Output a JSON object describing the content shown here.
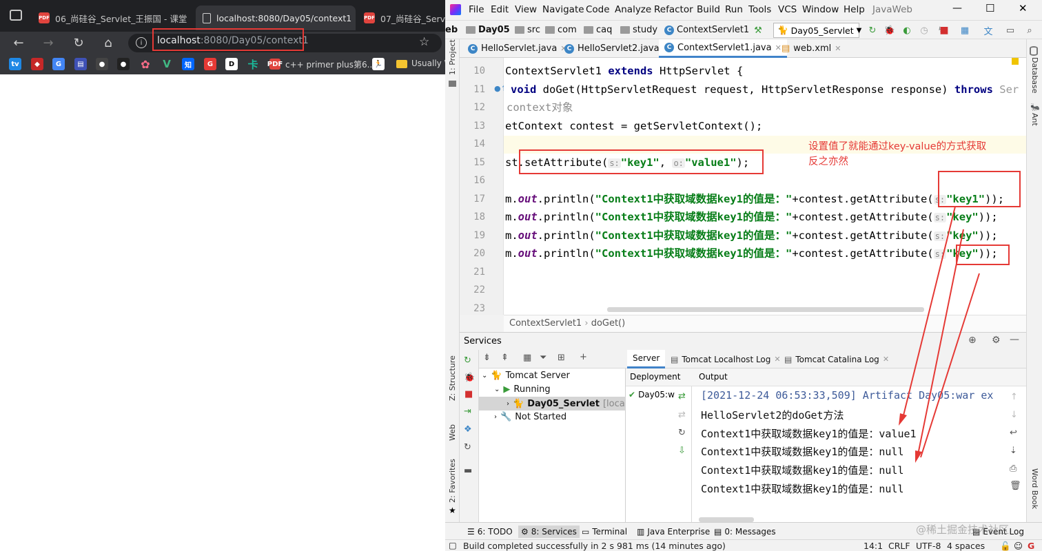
{
  "browser": {
    "tabs": [
      {
        "label": "06_尚硅谷_Servlet_王振国 - 课堂",
        "icon": "pdf-icon"
      },
      {
        "label": "localhost:8080/Day05/context1",
        "icon": "page-icon"
      },
      {
        "label": "07_尚硅谷_Servlet",
        "icon": "pdf-icon"
      }
    ],
    "url_host": "localhost",
    "url_rest": ":8080/Day05/context1",
    "bookmarks": [
      "c++ primer plus第6...",
      "Usually W"
    ]
  },
  "ide": {
    "menus": [
      "File",
      "Edit",
      "View",
      "Navigate",
      "Code",
      "Analyze",
      "Refactor",
      "Build",
      "Run",
      "Tools",
      "VCS",
      "Window",
      "Help"
    ],
    "project_title": "JavaWeb",
    "breadcrumbs": [
      "eb",
      "Day05",
      "src",
      "com",
      "caq",
      "study",
      "ContextServlet1"
    ],
    "run_config": "Day05_Servlet",
    "editor_tabs": [
      {
        "label": "HelloServlet.java",
        "active": false
      },
      {
        "label": "HelloServlet2.java",
        "active": false
      },
      {
        "label": "ContextServlet1.java",
        "active": true
      },
      {
        "label": "web.xml",
        "active": false
      }
    ],
    "line_numbers": [
      "10",
      "11",
      "12",
      "13",
      "14",
      "15",
      "16",
      "17",
      "18",
      "19",
      "20",
      "21",
      "22",
      "23"
    ],
    "code": {
      "l10_name": "ContextServlet1 ",
      "l10_kw": "extends",
      "l10_rest": " HttpServlet {",
      "l11_kw1": "void",
      "l11_mid": " doGet(HttpServletRequest request, HttpServletResponse response) ",
      "l11_kw2": "throws",
      "l11_end": " Ser",
      "l12_comment": "context对象",
      "l13": "etContext contest = getServletContext();",
      "l15_a": "st.setAttribute(",
      "hint_s": "s:",
      "hint_o": "o:",
      "key1": "\"key1\"",
      "comma": ", ",
      "value1": "\"value1\"",
      "l15_end": ");",
      "prefix_m": "m.",
      "out": "out",
      "println_open": ".println(",
      "msg": "\"Context1中获取域数据key1的值是：\"",
      "concat": "+contest.getAttribute(",
      "key": "\"key\"",
      "l17_end": "));",
      "l18_end": "));"
    },
    "annotation": [
      "设置值了就能通过key-value的方式获取",
      "反之亦然"
    ],
    "editor_breadcrumb": [
      "ContextServlet1",
      "doGet()"
    ],
    "services": {
      "title": "Services",
      "tree": [
        {
          "label": "Tomcat Server"
        },
        {
          "label": "Running"
        },
        {
          "label": "Day05_Servlet",
          "suffix": "[local]"
        },
        {
          "label": "Not Started"
        }
      ],
      "output_tabs": [
        "Server",
        "Tomcat Localhost Log",
        "Tomcat Catalina Log"
      ],
      "deployment_header": "Deployment",
      "output_header": "Output",
      "deployment_item": "Day05:w",
      "console_lines": [
        "[2021-12-24 06:53:33,509] Artifact Day05:war ex",
        "HelloServlet2的doGet方法",
        "Context1中获取域数据key1的值是：value1",
        "Context1中获取域数据key1的值是：null",
        "Context1中获取域数据key1的值是：null",
        "Context1中获取域数据key1的值是：null"
      ]
    },
    "left_strip": [
      "1: Project",
      "Z: Structure",
      "Web",
      "2: Favorites"
    ],
    "right_strip": [
      "Database",
      "Ant",
      "Word Book"
    ],
    "bottom_tabs": [
      "6: TODO",
      "8: Services",
      "Terminal",
      "Java Enterprise",
      "0: Messages",
      "Event Log"
    ],
    "status": {
      "message": "Build completed successfully in 2 s 981 ms (14 minutes ago)",
      "position": "14:1",
      "line_sep": "CRLF",
      "encoding": "UTF-8",
      "indent": "4 spaces"
    },
    "watermark": "@稀土掘金技术社区"
  }
}
